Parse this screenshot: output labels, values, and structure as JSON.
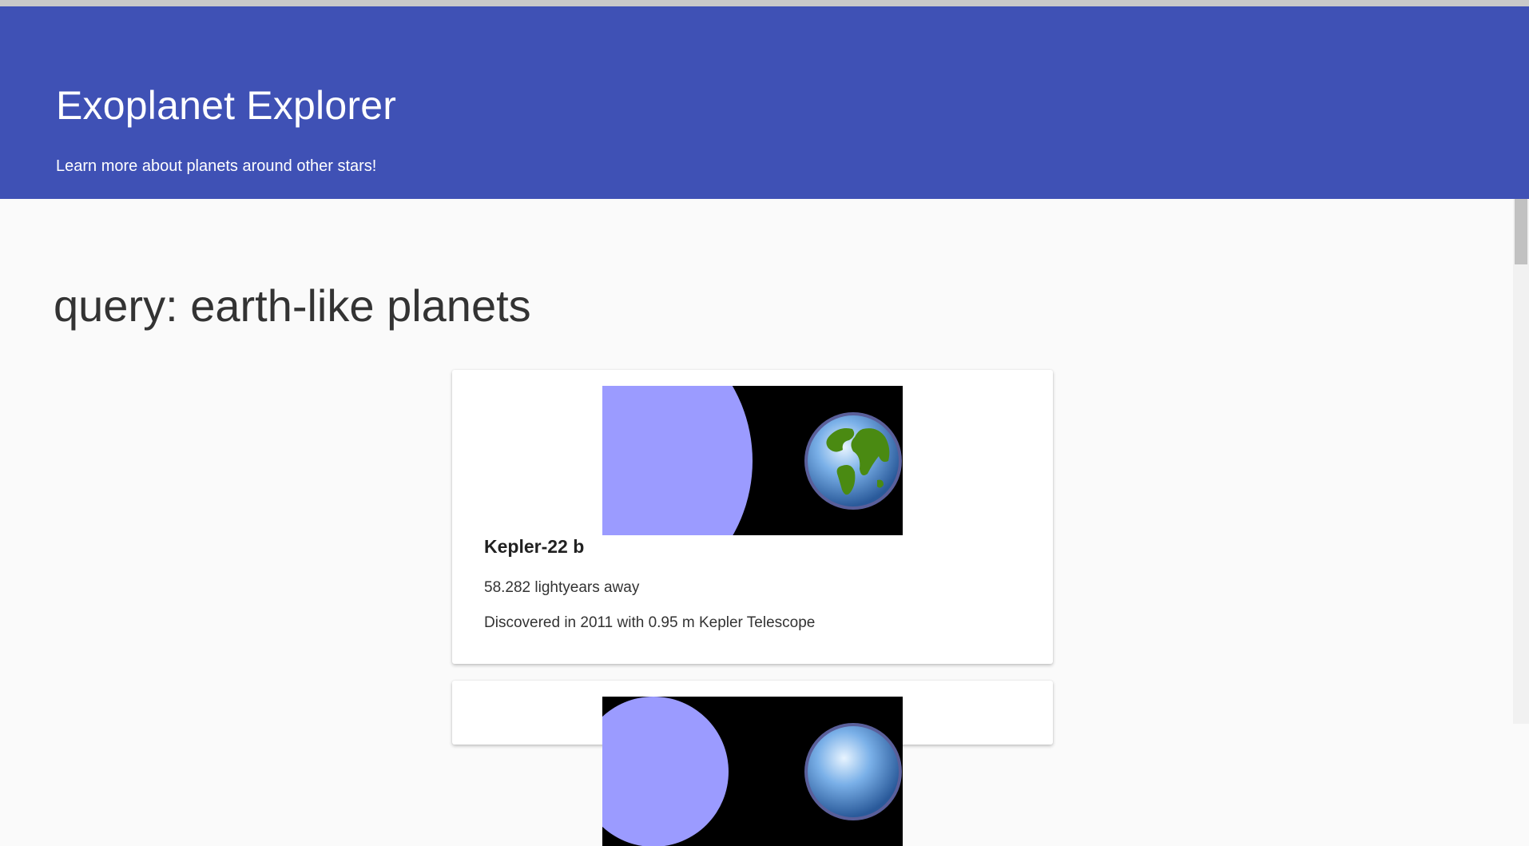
{
  "header": {
    "title": "Exoplanet Explorer",
    "subtitle": "Learn more about planets around other stars!",
    "background": "#3f51b5"
  },
  "query": {
    "label": "query: earth-like planets"
  },
  "results": [
    {
      "name": "Kepler-22 b",
      "distance": "58.282 lightyears away",
      "discovery": "Discovered in 2011 with 0.95 m Kepler Telescope",
      "star_color": "#9b9bff",
      "image_icons": [
        "star-disc",
        "earth-icon"
      ]
    },
    {
      "star_color": "#9b9bff",
      "image_icons": [
        "star-disc",
        "earth-icon"
      ]
    }
  ]
}
